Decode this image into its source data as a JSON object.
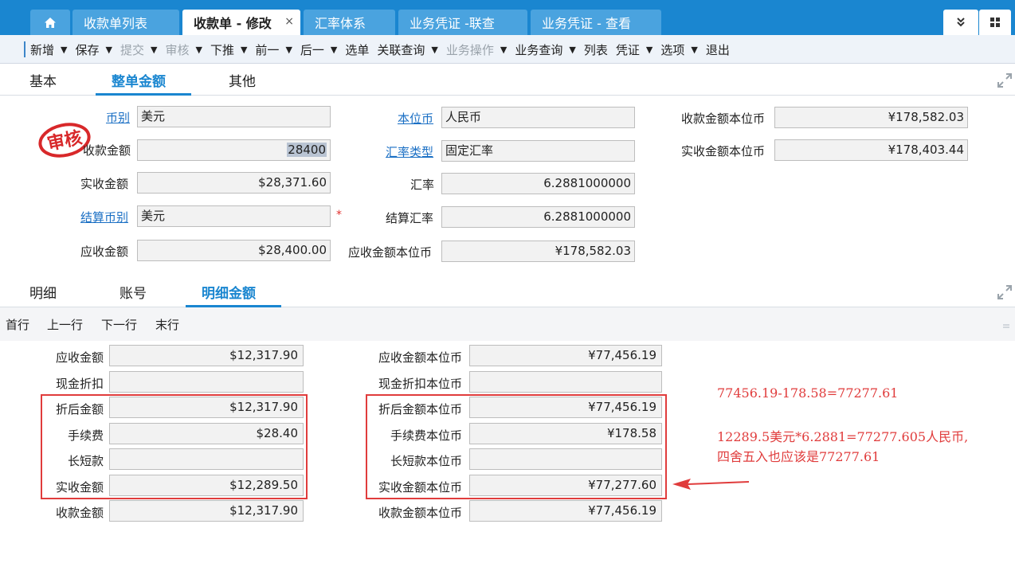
{
  "tabs": {
    "home_icon": "home-icon",
    "items": [
      {
        "label": "收款单列表"
      },
      {
        "label": "收款单 - 修改",
        "close": "×"
      },
      {
        "label": "汇率体系"
      },
      {
        "label": "业务凭证 -联查"
      },
      {
        "label": "业务凭证 - 查看"
      }
    ],
    "more_icon": "double-chevron-down-icon",
    "grid_icon": "grid-icon"
  },
  "toolbar": {
    "items": [
      {
        "label": "新增",
        "arrow": "▼",
        "disabled": false
      },
      {
        "label": "保存",
        "arrow": "▼",
        "disabled": false
      },
      {
        "label": "提交",
        "arrow": "▼",
        "disabled": true
      },
      {
        "label": "审核",
        "arrow": "▼",
        "disabled": true
      },
      {
        "label": "下推",
        "arrow": "▼",
        "disabled": false
      },
      {
        "label": "前一",
        "arrow": "▼",
        "disabled": false
      },
      {
        "label": "后一",
        "arrow": "▼",
        "disabled": false
      },
      {
        "label": "选单",
        "arrow": "",
        "disabled": false
      },
      {
        "label": "关联查询",
        "arrow": "▼",
        "disabled": false
      },
      {
        "label": "业务操作",
        "arrow": "▼",
        "disabled": true
      },
      {
        "label": "业务查询",
        "arrow": "▼",
        "disabled": false
      },
      {
        "label": "列表",
        "arrow": "",
        "disabled": false
      },
      {
        "label": "凭证",
        "arrow": "▼",
        "disabled": false
      },
      {
        "label": "选项",
        "arrow": "▼",
        "disabled": false
      },
      {
        "label": "退出",
        "arrow": "",
        "disabled": false
      }
    ]
  },
  "header_tabs": {
    "basic": "基本",
    "amount": "整单金额",
    "other": "其他"
  },
  "header": {
    "stamp_text": "审核",
    "currency_label": "币别",
    "currency": "美元",
    "base_currency_label": "本位币",
    "base_currency": "人民币",
    "receipt_base_label": "收款金额本位币",
    "receipt_base": "¥178,582.03",
    "receipt_amount_label": "收款金额",
    "receipt_amount": "28400",
    "rate_type_label": "汇率类型",
    "rate_type": "固定汇率",
    "actual_base_label": "实收金额本位币",
    "actual_base": "¥178,403.44",
    "actual_amount_label": "实收金额",
    "actual_amount": "$28,371.60",
    "rate_label": "汇率",
    "rate": "6.2881000000",
    "settle_currency_label": "结算币别",
    "settle_currency": "美元",
    "required_mark": "*",
    "settle_rate_label": "结算汇率",
    "settle_rate": "6.2881000000",
    "receivable_label": "应收金额",
    "receivable": "$28,400.00",
    "receivable_base_label": "应收金额本位币",
    "receivable_base": "¥178,582.03"
  },
  "detail_tabs": {
    "detail": "明细",
    "account": "账号",
    "detail_amount": "明细金额"
  },
  "detail_nav": {
    "first": "首行",
    "prev": "上一行",
    "next": "下一行",
    "last": "末行"
  },
  "detail": {
    "rows": [
      {
        "label": "应收金额",
        "value": "$12,317.90",
        "base_label": "应收金额本位币",
        "base_value": "¥77,456.19"
      },
      {
        "label": "现金折扣",
        "value": "",
        "base_label": "现金折扣本位币",
        "base_value": ""
      },
      {
        "label": "折后金额",
        "value": "$12,317.90",
        "base_label": "折后金额本位币",
        "base_value": "¥77,456.19"
      },
      {
        "label": "手续费",
        "value": "$28.40",
        "base_label": "手续费本位币",
        "base_value": "¥178.58"
      },
      {
        "label": "长短款",
        "value": "",
        "base_label": "长短款本位币",
        "base_value": ""
      },
      {
        "label": "实收金额",
        "value": "$12,289.50",
        "base_label": "实收金额本位币",
        "base_value": "¥77,277.60"
      },
      {
        "label": "收款金额",
        "value": "$12,317.90",
        "base_label": "收款金额本位币",
        "base_value": "¥77,456.19"
      }
    ]
  },
  "annotations": {
    "note1": "77456.19-178.58=77277.61",
    "note2_line1": "12289.5美元*6.2881=77277.605人民币,",
    "note2_line2": "四舍五入也应该是77277.61",
    "highlight_color": "#e03c3c"
  },
  "colors": {
    "accent": "#1a86d0",
    "link": "#1a6fc4"
  }
}
